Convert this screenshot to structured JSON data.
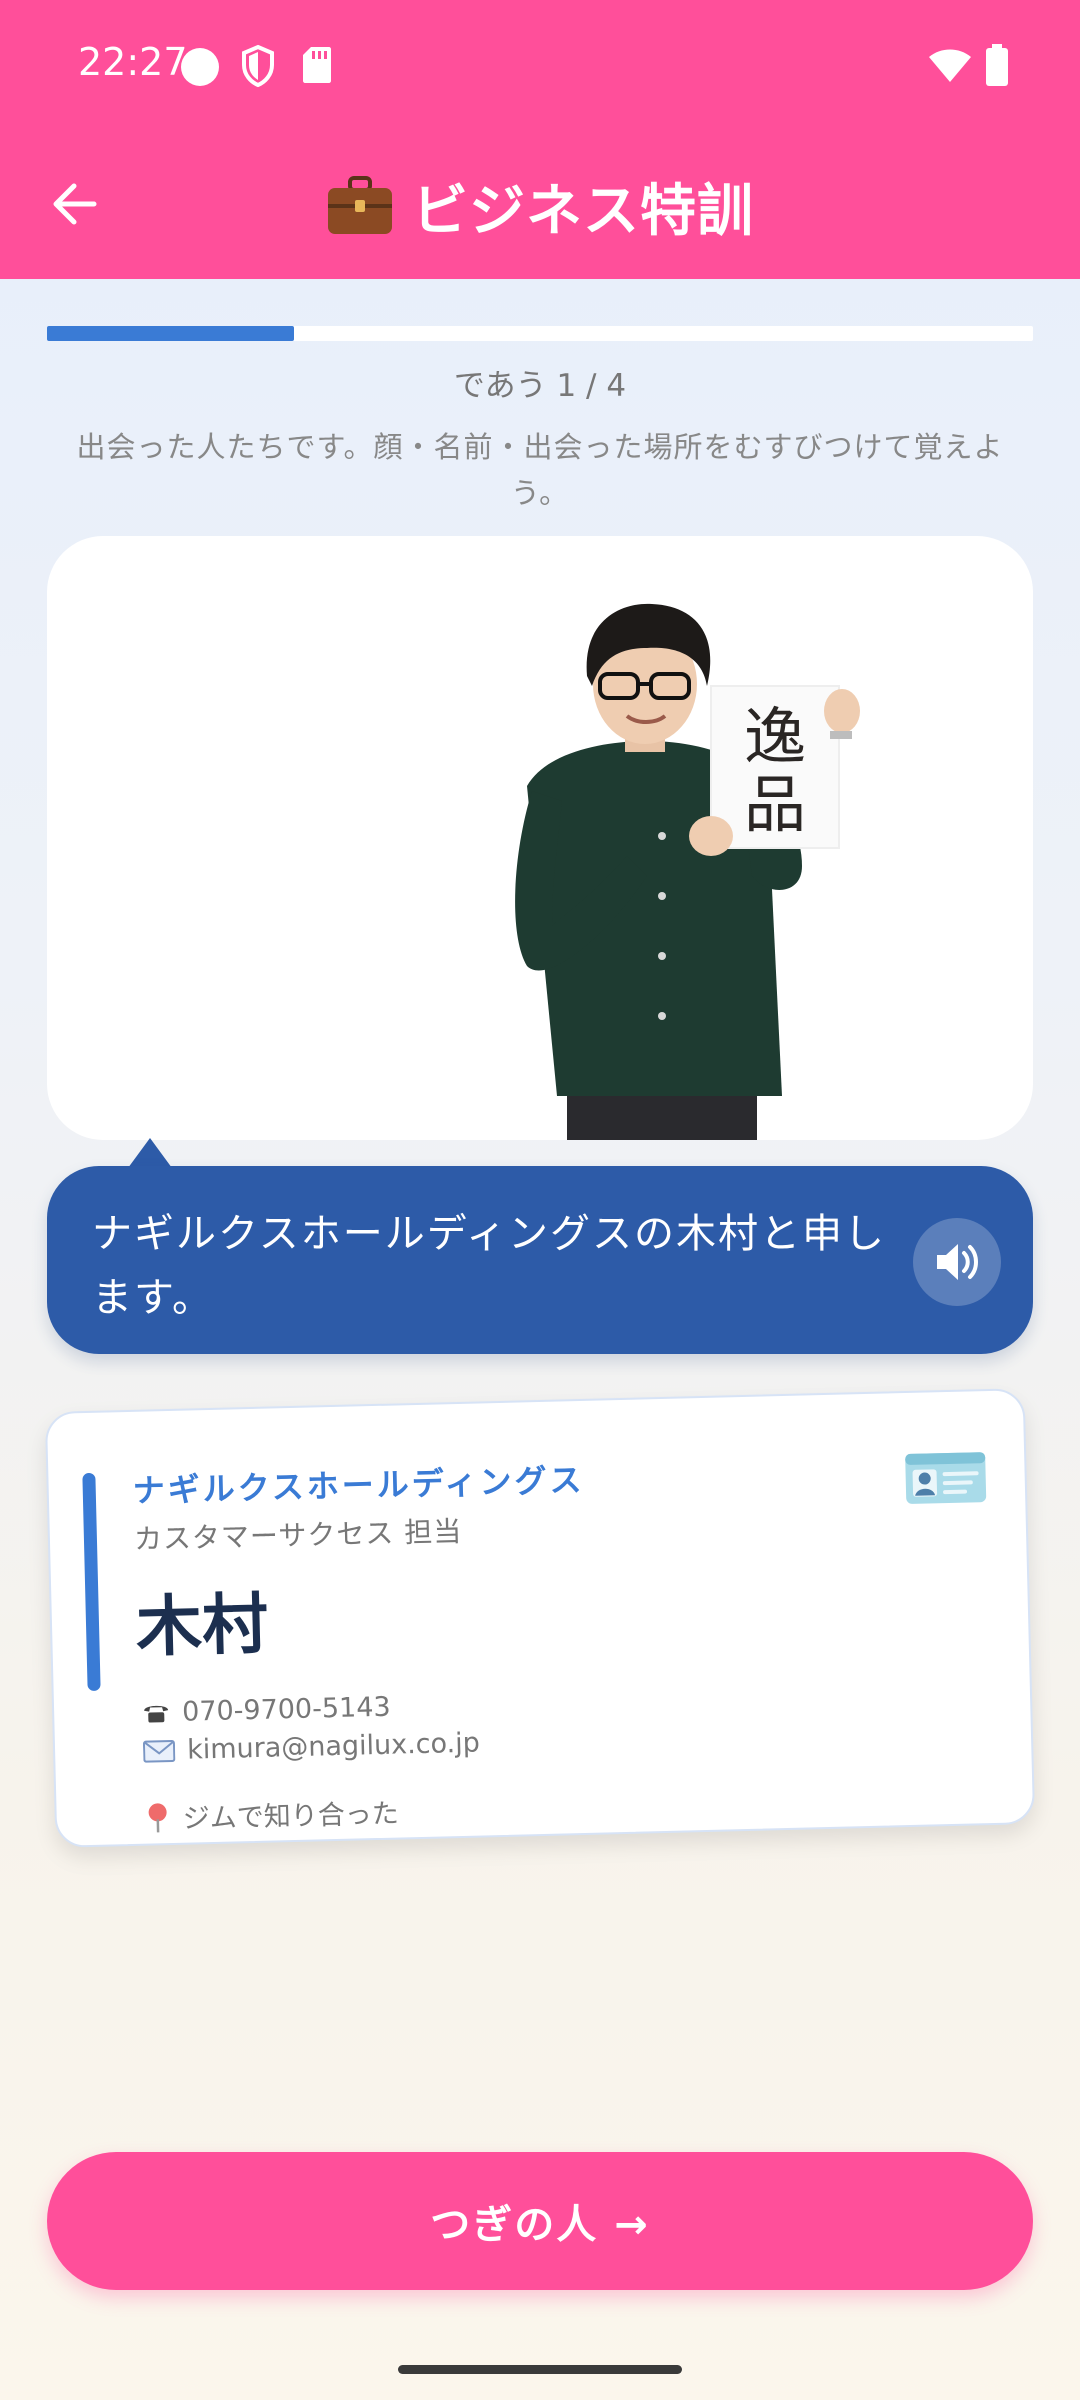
{
  "status_bar": {
    "time": "22:27",
    "icons": [
      "circle-icon",
      "shield-icon",
      "sd-card-icon",
      "wifi-icon",
      "battery-icon"
    ]
  },
  "header": {
    "back_icon": "arrow-left-icon",
    "title_icon": "briefcase-icon",
    "title": "ビジネス特訓",
    "background_color": "#ff4f9a"
  },
  "progress": {
    "fraction": 0.25,
    "step_label": "であう 1 / 4",
    "color": "#3a7bd5"
  },
  "instruction": "出会った人たちです。顔・名前・出会った場所をむすびつけて覚えよう。",
  "photo": {
    "sign_text": "逸品"
  },
  "speech": {
    "text": "ナギルクスホールディングスの木村と申します。",
    "speaker_icon": "speaker-icon",
    "background_color": "#2d5ba8"
  },
  "business_card": {
    "company": "ナギルクスホールディングス",
    "role": "カスタマーサクセス 担当",
    "name": "木村",
    "phone": "070-9700-5143",
    "email": "kimura@nagilux.co.jp",
    "met_at": "ジムで知り合った",
    "icons": [
      "id-card-icon",
      "phone-icon",
      "mail-icon",
      "pin-icon"
    ]
  },
  "next_button": {
    "label": "つぎの人 →",
    "color": "#ff4f9a"
  }
}
